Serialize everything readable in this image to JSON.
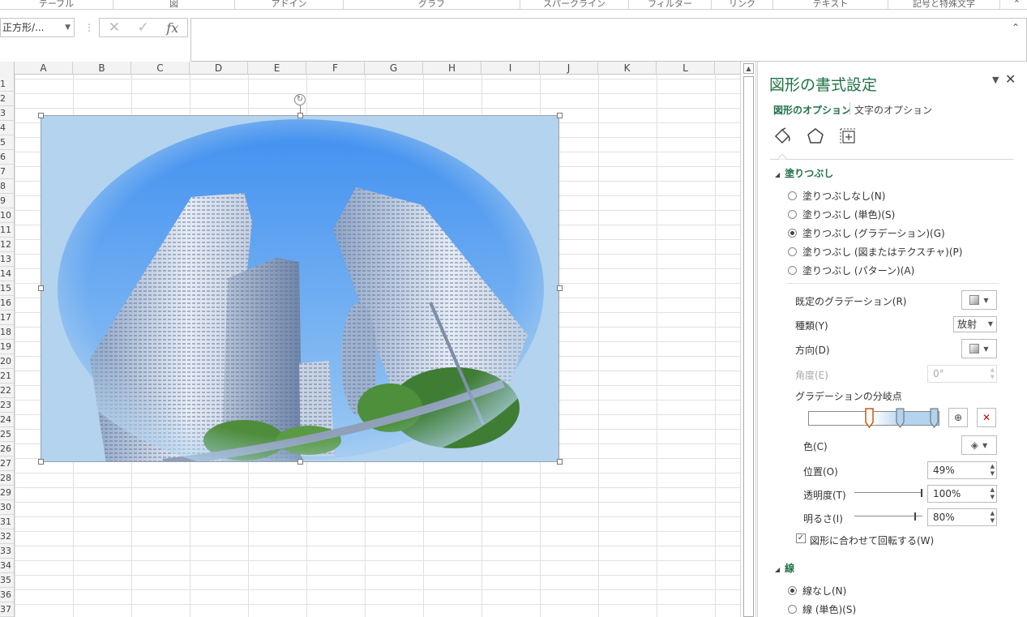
{
  "ribbon_groups": [
    "テーブル",
    "図",
    "アドイン",
    "グラフ",
    "スパークライン",
    "フィルター",
    "リンク",
    "テキスト",
    "記号と特殊文字"
  ],
  "formula_bar": {
    "name_box": "正方形/...",
    "cancel_icon": "✕",
    "enter_icon": "✓",
    "fx_label": "fx",
    "value": ""
  },
  "columns": [
    "A",
    "B",
    "C",
    "D",
    "E",
    "F",
    "G",
    "H",
    "I",
    "J",
    "K",
    "L"
  ],
  "rows": [
    "1",
    "2",
    "3",
    "4",
    "5",
    "6",
    "7",
    "8",
    "9",
    "10",
    "11",
    "12",
    "13",
    "14",
    "15",
    "16",
    "17",
    "18",
    "19",
    "20",
    "21",
    "22",
    "23",
    "24",
    "25",
    "26",
    "27",
    "28",
    "29",
    "30",
    "31",
    "32",
    "33",
    "34",
    "35",
    "36",
    "37"
  ],
  "shape": {
    "fill_color": "#b3d3ee",
    "sky_color": "#5aa3f0"
  },
  "pane": {
    "title": "図形の書式設定",
    "tabs": {
      "shape_options": "図形のオプション",
      "text_options": "文字のオプション"
    },
    "icons": [
      "fill-line-icon",
      "effects-icon",
      "size-properties-icon"
    ],
    "fill_section": {
      "heading": "塗りつぶし",
      "options": [
        {
          "label": "塗りつぶしなし(N)",
          "selected": false
        },
        {
          "label": "塗りつぶし (単色)(S)",
          "selected": false
        },
        {
          "label": "塗りつぶし (グラデーション)(G)",
          "selected": true
        },
        {
          "label": "塗りつぶし (図またはテクスチャ)(P)",
          "selected": false
        },
        {
          "label": "塗りつぶし (パターン)(A)",
          "selected": false
        }
      ],
      "preset_label": "既定のグラデーション(R)",
      "type_label": "種類(Y)",
      "type_value": "放射",
      "direction_label": "方向(D)",
      "angle_label": "角度(E)",
      "angle_value": "0°",
      "stops_label": "グラデーションの分岐点",
      "color_label": "色(C)",
      "position_label": "位置(O)",
      "position_value": "49%",
      "transparency_label": "透明度(T)",
      "transparency_value": "100%",
      "transparency_level": 1.0,
      "brightness_label": "明るさ(I)",
      "brightness_value": "80%",
      "brightness_level": 0.9,
      "rotate_label": "図形に合わせて回転する(W)",
      "rotate_checked": true
    },
    "line_section": {
      "heading": "線",
      "options": [
        {
          "label": "線なし(N)",
          "selected": true
        },
        {
          "label": "線 (単色)(S)",
          "selected": false
        }
      ]
    }
  },
  "colors": {
    "accent": "#217346",
    "stop_selected": "#c55a11"
  }
}
